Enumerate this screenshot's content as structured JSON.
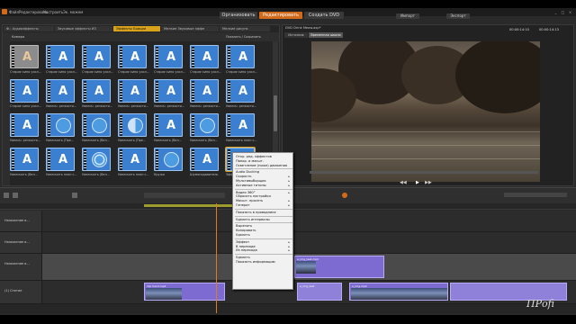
{
  "menubar": {
    "items": [
      "Файл",
      "Редактировать",
      "Настроить",
      "Эк. можем"
    ],
    "modes": [
      "Организовать",
      "Редактировать",
      "Создать DVD"
    ],
    "active_mode": "Редактировать",
    "import_label": "Импорт",
    "export_label": "Экспорт"
  },
  "library": {
    "tabs": [
      "Ф.: Аудиоэффекты",
      "Звуковые эффекты ИЗ",
      "Эффекты Боиции",
      "Мелкие Звуковые эффе",
      "Мелкие рисунк"
    ],
    "active_tab": "Эффекты Боиции",
    "subbar_left": "Камера",
    "subbar_right": "Показать / Сохранить",
    "thumbnails": [
      {
        "label": "Старое кино усил..."
      },
      {
        "label": "Старое кино усил..."
      },
      {
        "label": "Старое кино усил..."
      },
      {
        "label": "Старое кино усил..."
      },
      {
        "label": "Старое кино усил..."
      },
      {
        "label": "Старое кино усил..."
      },
      {
        "label": "Старое кино усил..."
      },
      {
        "label": "Старое кино усил..."
      },
      {
        "label": "Увелич. резкости..."
      },
      {
        "label": "Увелич. резкости..."
      },
      {
        "label": "Увелич. резкости..."
      },
      {
        "label": "Увелич. резкости..."
      },
      {
        "label": "Увелич. резкости..."
      },
      {
        "label": "Увелич. резкости..."
      },
      {
        "label": "Увелич. резкости..."
      },
      {
        "label": "Увеличить (Пре..."
      },
      {
        "label": "Увеличить (Вел..."
      },
      {
        "label": "Увеличить (Пре..."
      },
      {
        "label": "Увеличить (Вел..."
      },
      {
        "label": "Увеличить (Вел..."
      },
      {
        "label": "Увеличить план с..."
      },
      {
        "label": "Увеличить (Вел..."
      },
      {
        "label": "Увеличить план с..."
      },
      {
        "label": "Увеличить (Вел..."
      },
      {
        "label": "Увеличить план с..."
      },
      {
        "label": "Кружи"
      },
      {
        "label": "Шумоподавитель"
      },
      {
        "label": "Эффект Вильмот..."
      }
    ]
  },
  "player": {
    "title": "DVD Drink Meow.axp*",
    "tabs": [
      "Источник",
      "Временная шкала"
    ],
    "timecode": "00:00:14:10",
    "duration": "00:00:14:13"
  },
  "timeline": {
    "tracks": [
      {
        "name": "Наложение в..."
      },
      {
        "name": "Наложение в..."
      },
      {
        "name": "Наложение в..."
      },
      {
        "name": "(1) Снятие"
      }
    ],
    "clips": [
      {
        "title": "clip hand.mp4"
      },
      {
        "title": "a_img_test.mp4"
      },
      {
        "title": "a_img.mp4"
      },
      {
        "title": "a_img_test"
      }
    ]
  },
  "context_menu": {
    "items": [
      {
        "label": "Откр. ред. эффектов",
        "submenu": false
      },
      {
        "label": "Панор. и масшт.",
        "submenu": false
      },
      {
        "label": "Осветление (ниже) движения",
        "submenu": false
      },
      {
        "sep": true
      },
      {
        "label": "Audio Ducking",
        "submenu": false
      },
      {
        "label": "Скорость",
        "submenu": true
      },
      {
        "label": "Мультивыборщик",
        "submenu": true
      },
      {
        "label": "Активные титоны",
        "submenu": true
      },
      {
        "sep": true
      },
      {
        "label": "Видео 360°",
        "submenu": true
      },
      {
        "label": "Сбросить настройки",
        "submenu": false
      },
      {
        "label": "Масшт. просеть",
        "submenu": true
      },
      {
        "label": "Генерат",
        "submenu": true
      },
      {
        "sep": true
      },
      {
        "label": "Показать в проводнике",
        "submenu": false
      },
      {
        "sep": true
      },
      {
        "label": "Удалить интервалы",
        "submenu": false
      },
      {
        "sep": true
      },
      {
        "label": "Вырезать",
        "submenu": false
      },
      {
        "label": "Копировать",
        "submenu": false
      },
      {
        "label": "Удалить",
        "submenu": false
      },
      {
        "sep": true
      },
      {
        "label": "Эффект",
        "submenu": true
      },
      {
        "label": "В переходе",
        "submenu": true
      },
      {
        "label": "Из перехода",
        "submenu": true
      },
      {
        "sep": true
      },
      {
        "label": "Удалить",
        "submenu": false
      },
      {
        "label": "Показать информацию",
        "submenu": false
      }
    ]
  },
  "watermark": "ПРofi",
  "colors": {
    "accent": "#d26a1c",
    "tab_active": "#d9a21b",
    "thumb_blue": "#3a7fd0",
    "clip_purple": "#7d6bd1"
  }
}
